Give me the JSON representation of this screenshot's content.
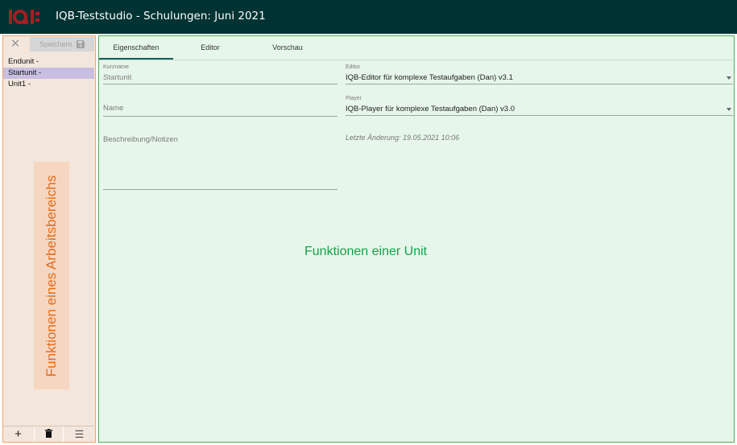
{
  "header": {
    "logo_text": "IQB",
    "title": "IQB-Teststudio - Schulungen: Juni 2021"
  },
  "sidebar": {
    "save_label": "Speichern",
    "units": [
      {
        "label": "Endunit -",
        "selected": false
      },
      {
        "label": "Startunit -",
        "selected": true
      },
      {
        "label": "Unit1 -",
        "selected": false
      }
    ],
    "annotation": "Funktionen eines Arbeitsbereichs",
    "bottom_buttons": [
      "add-icon",
      "trash-icon",
      "menu-icon"
    ]
  },
  "main": {
    "tabs": [
      {
        "label": "Eigenschaften",
        "active": true
      },
      {
        "label": "Editor",
        "active": false
      },
      {
        "label": "Vorschau",
        "active": false
      }
    ],
    "form": {
      "kurzname_label": "Kurzname",
      "kurzname_value": "Startunit",
      "name_placeholder": "Name",
      "beschreibung_placeholder": "Beschreibung/Notizen",
      "editor_label": "Editor",
      "editor_value": "IQB-Editor für komplexe Testaufgaben (Dan) v3.1",
      "player_label": "Player",
      "player_value": "IQB-Player für komplexe Testaufgaben (Dan) v3.0",
      "last_change": "Letzte Änderung: 19.05.2021 10:06"
    },
    "annotation": "Funktionen einer Unit"
  },
  "colors": {
    "header_bg": "#003333",
    "sidebar_bg": "#f3e6dc",
    "sidebar_border": "#f0a36a",
    "main_bg": "#e6f6ea",
    "main_border": "#4caf50",
    "selected_unit_bg": "#c8bfe0",
    "active_tab_ink": "#12605a",
    "annotation_orange": "#e46d1a",
    "annotation_green": "#15a24a"
  }
}
